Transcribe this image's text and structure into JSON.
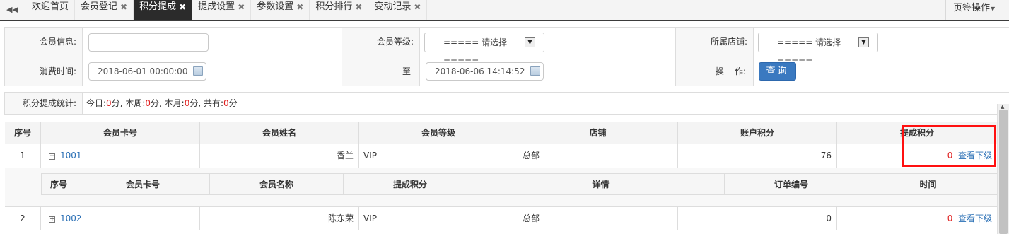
{
  "tabbar": {
    "prev_icon": "◀◀",
    "tabs": [
      {
        "label": "欢迎首页",
        "closable": false,
        "active": false
      },
      {
        "label": "会员登记",
        "closable": true,
        "active": false
      },
      {
        "label": "积分提成",
        "closable": true,
        "active": true
      },
      {
        "label": "提成设置",
        "closable": true,
        "active": false
      },
      {
        "label": "参数设置",
        "closable": true,
        "active": false
      },
      {
        "label": "积分排行",
        "closable": true,
        "active": false
      },
      {
        "label": "变动记录",
        "closable": true,
        "active": false
      }
    ],
    "close_glyph": "✖",
    "page_ops_label": "页签操作"
  },
  "form": {
    "member_info_label": "会员信息:",
    "member_info_value": "",
    "member_level_label": "会员等级:",
    "member_level_value": "===== 请选择 =====",
    "store_label": "所属店铺:",
    "store_value": "===== 请选择 =====",
    "time_label": "消费时间:",
    "start_time": "2018-06-01 00:00:00",
    "to_label": "至",
    "end_time": "2018-06-06 14:14:52",
    "ops_label": "操    作:",
    "query_button": "查询"
  },
  "stats": {
    "label": "积分提成统计:",
    "today_label": "今日:",
    "today_value": "0",
    "week_label": "分, 本周:",
    "week_value": "0",
    "month_label": "分, 本月:",
    "month_value": "0",
    "total_label": "分, 共有:",
    "total_value": "0",
    "unit": "分"
  },
  "table": {
    "headers": [
      "序号",
      "会员卡号",
      "会员姓名",
      "会员等级",
      "店铺",
      "账户积分",
      "提成积分"
    ],
    "rows": [
      {
        "index": "1",
        "toggle": "−",
        "card_no": "1001",
        "name": "香兰",
        "level": "VIP",
        "store": "总部",
        "points": "76",
        "commission": "0",
        "action": "查看下级"
      },
      {
        "index": "2",
        "toggle": "+",
        "card_no": "1002",
        "name": "陈东荣",
        "level": "VIP",
        "store": "总部",
        "points": "0",
        "commission": "0",
        "action": "查看下级"
      }
    ],
    "sub_headers": [
      "序号",
      "会员卡号",
      "会员名称",
      "提成积分",
      "详情",
      "订单编号",
      "时间"
    ]
  }
}
